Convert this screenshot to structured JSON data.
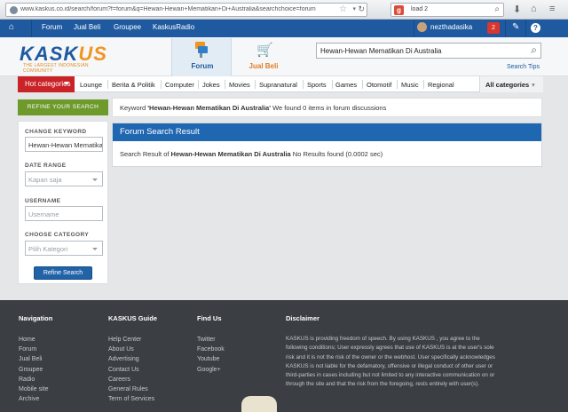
{
  "browser": {
    "url": "www.kaskus.co.id/search/forum?f=forum&q=Hewan-Hewan+Mematikan+Di+Australia&searchchoice=forum",
    "search_engine_icon": "google-icon",
    "search_value": "load 2"
  },
  "topnav": {
    "items": [
      "Forum",
      "Jual Beli",
      "Groupee",
      "KaskusRadio"
    ],
    "username": "nezthadasika",
    "notification_count": "2"
  },
  "header": {
    "logo_main": "KASK",
    "logo_accent": "US",
    "tagline": "THE LARGEST INDONESIAN COMMUNITY",
    "tabs": [
      "Forum",
      "Jual Beli"
    ],
    "search_value": "Hewan-Hewan Mematikan Di Australia",
    "search_tips": "Search Tips"
  },
  "categories": {
    "hot": "Hot categories",
    "items": [
      "Lounge",
      "Berita & Politik",
      "Computer",
      "Jokes",
      "Movies",
      "Supranatural",
      "Sports",
      "Games",
      "Otomotif",
      "Music",
      "Regional"
    ],
    "all": "All categories"
  },
  "refine": {
    "heading": "REFINE YOUR SEARCH",
    "change_keyword_label": "CHANGE KEYWORD",
    "keyword_value": "Hewan-Hewan Mematikan Di Australia",
    "date_range_label": "DATE RANGE",
    "date_range_value": "Kapan saja",
    "username_label": "USERNAME",
    "username_placeholder": "Username",
    "choose_category_label": "CHOOSE CATEGORY",
    "category_placeholder": "Pilih Kategori",
    "button": "Refine Search"
  },
  "keyword_bar": {
    "prefix": "Keyword ",
    "keyword": "'Hewan-Hewan Mematikan Di Australia'",
    "suffix": " We found 0 items in forum discussions"
  },
  "result": {
    "title": "Forum Search Result",
    "prefix": "Search Result of ",
    "keyword": "Hewan-Hewan Mematikan Di Australia",
    "suffix": " No Results found (0.0002 sec)"
  },
  "footer": {
    "navigation": {
      "title": "Navigation",
      "links": [
        "Home",
        "Forum",
        "Jual Beli",
        "Groupee",
        "Radio",
        "Mobile site",
        "Archive"
      ]
    },
    "guide": {
      "title": "KASKUS Guide",
      "links": [
        "Help Center",
        "About Us",
        "Advertising",
        "Contact Us",
        "Careers",
        "General Rules",
        "Term of Services"
      ]
    },
    "findus": {
      "title": "Find Us",
      "links": [
        "Twitter",
        "Facebook",
        "Youtube",
        "Google+"
      ]
    },
    "disclaimer": {
      "title": "Disclaimer",
      "text": "KASKUS is providing freedom of speech. By using KASKUS , you agree to the following conditions; User expressly agrees that use of KASKUS is at the user's sole risk and it is not the risk of the owner or the webhost. User specifically acknowledges KASKUS is not liable for the defamatory, offensive or illegal conduct of other user or third-parties in cases including but not limited to any interactive communication on or through the site and that the risk from the foregoing, rests entirely with user(s)."
    }
  },
  "colors": {
    "nav_blue": "#1f5aa0",
    "hot_red": "#c92227",
    "refine_green": "#6d9a2b",
    "result_header": "#2067b1",
    "footer_bg": "#3b3e42",
    "logo_orange": "#f0951d"
  }
}
